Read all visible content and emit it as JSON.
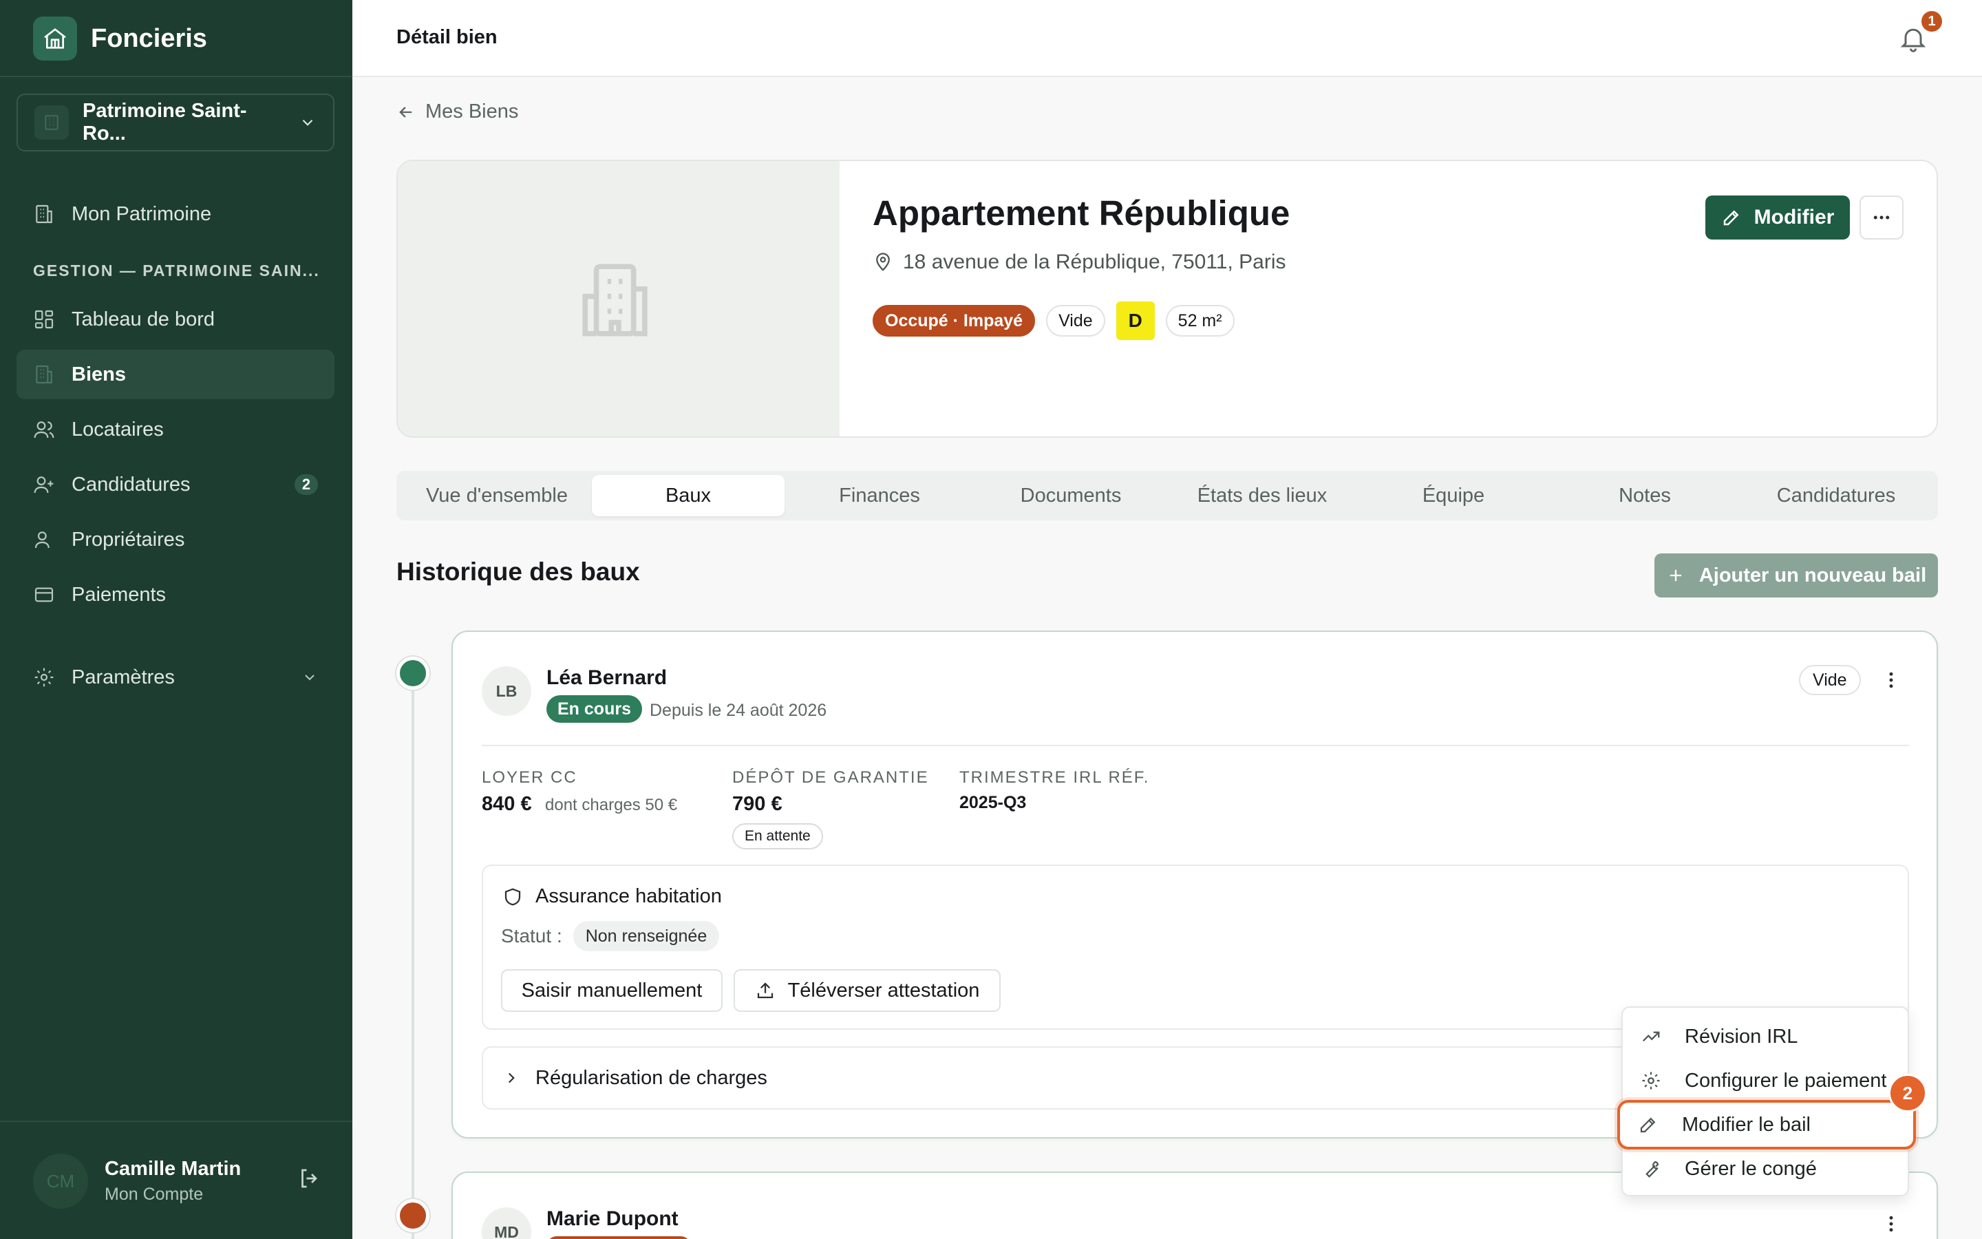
{
  "app": {
    "name": "Foncieris"
  },
  "sidebar": {
    "portfolio_label": "Patrimoine Saint-Ro...",
    "top_item": "Mon Patrimoine",
    "section_header": "GESTION — PATRIMOINE SAIN...",
    "items": [
      {
        "label": "Tableau de bord",
        "icon": "dashboard-icon"
      },
      {
        "label": "Biens",
        "icon": "building-icon",
        "active": true
      },
      {
        "label": "Locataires",
        "icon": "users-icon"
      },
      {
        "label": "Candidatures",
        "icon": "user-plus-icon",
        "badge": "2"
      },
      {
        "label": "Propriétaires",
        "icon": "user-icon"
      },
      {
        "label": "Paiements",
        "icon": "credit-card-icon"
      }
    ],
    "settings_label": "Paramètres",
    "user": {
      "initials": "CM",
      "name": "Camille Martin",
      "subtitle": "Mon Compte"
    }
  },
  "header": {
    "title": "Détail bien",
    "notification_count": "1"
  },
  "breadcrumb": {
    "back_label": "Mes Biens"
  },
  "property": {
    "title": "Appartement République",
    "address": "18 avenue de la République, 75011, Paris",
    "tags": {
      "status": "Occupé · Impayé",
      "furnishing": "Vide",
      "dpe": "D",
      "surface": "52 m²"
    },
    "edit_label": "Modifier"
  },
  "tabs": [
    "Vue d'ensemble",
    "Baux",
    "Finances",
    "Documents",
    "États des lieux",
    "Équipe",
    "Notes",
    "Candidatures"
  ],
  "active_tab": "Baux",
  "history": {
    "title": "Historique des baux",
    "add_label": "Ajouter un nouveau bail"
  },
  "leases": [
    {
      "initials": "LB",
      "name": "Léa Bernard",
      "status": "En cours",
      "since": "Depuis le 24 août 2026",
      "type": "Vide",
      "rent_label": "LOYER CC",
      "rent_value": "840 €",
      "rent_sub": "dont charges 50 €",
      "deposit_label": "DÉPÔT DE GARANTIE",
      "deposit_value": "790 €",
      "deposit_status": "En attente",
      "irl_label": "TRIMESTRE IRL RÉF.",
      "irl_value": "2025-Q3",
      "insurance_title": "Assurance habitation",
      "insurance_status_label": "Statut :",
      "insurance_status": "Non renseignée",
      "manual_btn": "Saisir manuellement",
      "upload_btn": "Téléverser attestation",
      "charges_label": "Régularisation de charges"
    },
    {
      "initials": "MD",
      "name": "Marie Dupont"
    }
  ],
  "context_menu": {
    "items": [
      {
        "label": "Révision IRL",
        "icon": "trending-up-icon"
      },
      {
        "label": "Configurer le paiement",
        "icon": "gear-icon"
      },
      {
        "label": "Modifier le bail",
        "icon": "pencil-icon",
        "highlighted": true
      },
      {
        "label": "Gérer le congé",
        "icon": "wrench-icon"
      }
    ],
    "step_badge": "2"
  },
  "colors": {
    "sidebar": "#1e3d31",
    "primary": "#1e5c44",
    "status_green": "#2e7d5b",
    "status_red": "#b84a1e",
    "highlight": "#e4642c",
    "dpe_yellow": "#f4ec14"
  }
}
